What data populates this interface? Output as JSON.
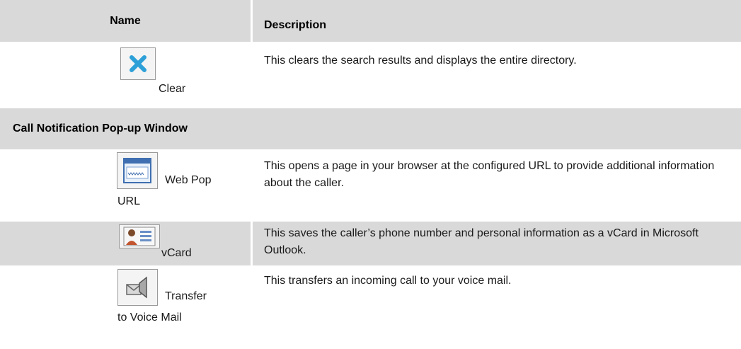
{
  "header": {
    "name": "Name",
    "description": "Description"
  },
  "rows": [
    {
      "label": "Clear",
      "icon": "clear-x-icon",
      "description": "This clears the search results and displays the entire directory."
    }
  ],
  "section": {
    "title": "Call Notification Pop-up Window"
  },
  "section_rows": [
    {
      "label_line1": "Web Pop",
      "label_line2": "URL",
      "icon": "web-page-icon",
      "description": "This opens a page in your browser at the configured URL to provide additional information about the caller."
    },
    {
      "label": "vCard",
      "icon": "vcard-contact-icon",
      "description": "This saves the caller’s phone number and personal information as a vCard in Microsoft Outlook."
    },
    {
      "label_line1": "Transfer",
      "label_line2": "to Voice Mail",
      "icon": "voicemail-transfer-icon",
      "description": "This transfers an incoming call to your voice mail."
    }
  ],
  "colors": {
    "band": "#d9d9d9",
    "clear_icon": "#2ea0d8"
  }
}
